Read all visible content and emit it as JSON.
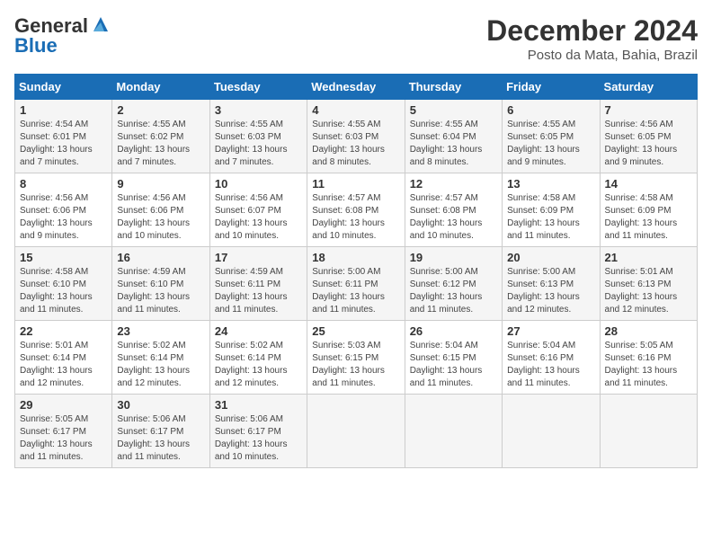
{
  "header": {
    "logo_line1": "General",
    "logo_line2": "Blue",
    "title": "December 2024",
    "subtitle": "Posto da Mata, Bahia, Brazil"
  },
  "calendar": {
    "days_of_week": [
      "Sunday",
      "Monday",
      "Tuesday",
      "Wednesday",
      "Thursday",
      "Friday",
      "Saturday"
    ],
    "weeks": [
      [
        null,
        null,
        {
          "day": "3",
          "sunrise": "Sunrise: 4:55 AM",
          "sunset": "Sunset: 6:03 PM",
          "daylight": "Daylight: 13 hours and 7 minutes."
        },
        {
          "day": "4",
          "sunrise": "Sunrise: 4:55 AM",
          "sunset": "Sunset: 6:03 PM",
          "daylight": "Daylight: 13 hours and 8 minutes."
        },
        {
          "day": "5",
          "sunrise": "Sunrise: 4:55 AM",
          "sunset": "Sunset: 6:04 PM",
          "daylight": "Daylight: 13 hours and 8 minutes."
        },
        {
          "day": "6",
          "sunrise": "Sunrise: 4:55 AM",
          "sunset": "Sunset: 6:05 PM",
          "daylight": "Daylight: 13 hours and 9 minutes."
        },
        {
          "day": "7",
          "sunrise": "Sunrise: 4:56 AM",
          "sunset": "Sunset: 6:05 PM",
          "daylight": "Daylight: 13 hours and 9 minutes."
        }
      ],
      [
        {
          "day": "1",
          "sunrise": "Sunrise: 4:54 AM",
          "sunset": "Sunset: 6:01 PM",
          "daylight": "Daylight: 13 hours and 7 minutes."
        },
        {
          "day": "2",
          "sunrise": "Sunrise: 4:55 AM",
          "sunset": "Sunset: 6:02 PM",
          "daylight": "Daylight: 13 hours and 7 minutes."
        },
        null,
        null,
        null,
        null,
        null
      ],
      [
        {
          "day": "8",
          "sunrise": "Sunrise: 4:56 AM",
          "sunset": "Sunset: 6:06 PM",
          "daylight": "Daylight: 13 hours and 9 minutes."
        },
        {
          "day": "9",
          "sunrise": "Sunrise: 4:56 AM",
          "sunset": "Sunset: 6:06 PM",
          "daylight": "Daylight: 13 hours and 10 minutes."
        },
        {
          "day": "10",
          "sunrise": "Sunrise: 4:56 AM",
          "sunset": "Sunset: 6:07 PM",
          "daylight": "Daylight: 13 hours and 10 minutes."
        },
        {
          "day": "11",
          "sunrise": "Sunrise: 4:57 AM",
          "sunset": "Sunset: 6:08 PM",
          "daylight": "Daylight: 13 hours and 10 minutes."
        },
        {
          "day": "12",
          "sunrise": "Sunrise: 4:57 AM",
          "sunset": "Sunset: 6:08 PM",
          "daylight": "Daylight: 13 hours and 10 minutes."
        },
        {
          "day": "13",
          "sunrise": "Sunrise: 4:58 AM",
          "sunset": "Sunset: 6:09 PM",
          "daylight": "Daylight: 13 hours and 11 minutes."
        },
        {
          "day": "14",
          "sunrise": "Sunrise: 4:58 AM",
          "sunset": "Sunset: 6:09 PM",
          "daylight": "Daylight: 13 hours and 11 minutes."
        }
      ],
      [
        {
          "day": "15",
          "sunrise": "Sunrise: 4:58 AM",
          "sunset": "Sunset: 6:10 PM",
          "daylight": "Daylight: 13 hours and 11 minutes."
        },
        {
          "day": "16",
          "sunrise": "Sunrise: 4:59 AM",
          "sunset": "Sunset: 6:10 PM",
          "daylight": "Daylight: 13 hours and 11 minutes."
        },
        {
          "day": "17",
          "sunrise": "Sunrise: 4:59 AM",
          "sunset": "Sunset: 6:11 PM",
          "daylight": "Daylight: 13 hours and 11 minutes."
        },
        {
          "day": "18",
          "sunrise": "Sunrise: 5:00 AM",
          "sunset": "Sunset: 6:11 PM",
          "daylight": "Daylight: 13 hours and 11 minutes."
        },
        {
          "day": "19",
          "sunrise": "Sunrise: 5:00 AM",
          "sunset": "Sunset: 6:12 PM",
          "daylight": "Daylight: 13 hours and 11 minutes."
        },
        {
          "day": "20",
          "sunrise": "Sunrise: 5:00 AM",
          "sunset": "Sunset: 6:13 PM",
          "daylight": "Daylight: 13 hours and 12 minutes."
        },
        {
          "day": "21",
          "sunrise": "Sunrise: 5:01 AM",
          "sunset": "Sunset: 6:13 PM",
          "daylight": "Daylight: 13 hours and 12 minutes."
        }
      ],
      [
        {
          "day": "22",
          "sunrise": "Sunrise: 5:01 AM",
          "sunset": "Sunset: 6:14 PM",
          "daylight": "Daylight: 13 hours and 12 minutes."
        },
        {
          "day": "23",
          "sunrise": "Sunrise: 5:02 AM",
          "sunset": "Sunset: 6:14 PM",
          "daylight": "Daylight: 13 hours and 12 minutes."
        },
        {
          "day": "24",
          "sunrise": "Sunrise: 5:02 AM",
          "sunset": "Sunset: 6:14 PM",
          "daylight": "Daylight: 13 hours and 12 minutes."
        },
        {
          "day": "25",
          "sunrise": "Sunrise: 5:03 AM",
          "sunset": "Sunset: 6:15 PM",
          "daylight": "Daylight: 13 hours and 11 minutes."
        },
        {
          "day": "26",
          "sunrise": "Sunrise: 5:04 AM",
          "sunset": "Sunset: 6:15 PM",
          "daylight": "Daylight: 13 hours and 11 minutes."
        },
        {
          "day": "27",
          "sunrise": "Sunrise: 5:04 AM",
          "sunset": "Sunset: 6:16 PM",
          "daylight": "Daylight: 13 hours and 11 minutes."
        },
        {
          "day": "28",
          "sunrise": "Sunrise: 5:05 AM",
          "sunset": "Sunset: 6:16 PM",
          "daylight": "Daylight: 13 hours and 11 minutes."
        }
      ],
      [
        {
          "day": "29",
          "sunrise": "Sunrise: 5:05 AM",
          "sunset": "Sunset: 6:17 PM",
          "daylight": "Daylight: 13 hours and 11 minutes."
        },
        {
          "day": "30",
          "sunrise": "Sunrise: 5:06 AM",
          "sunset": "Sunset: 6:17 PM",
          "daylight": "Daylight: 13 hours and 11 minutes."
        },
        {
          "day": "31",
          "sunrise": "Sunrise: 5:06 AM",
          "sunset": "Sunset: 6:17 PM",
          "daylight": "Daylight: 13 hours and 10 minutes."
        },
        null,
        null,
        null,
        null
      ]
    ]
  }
}
